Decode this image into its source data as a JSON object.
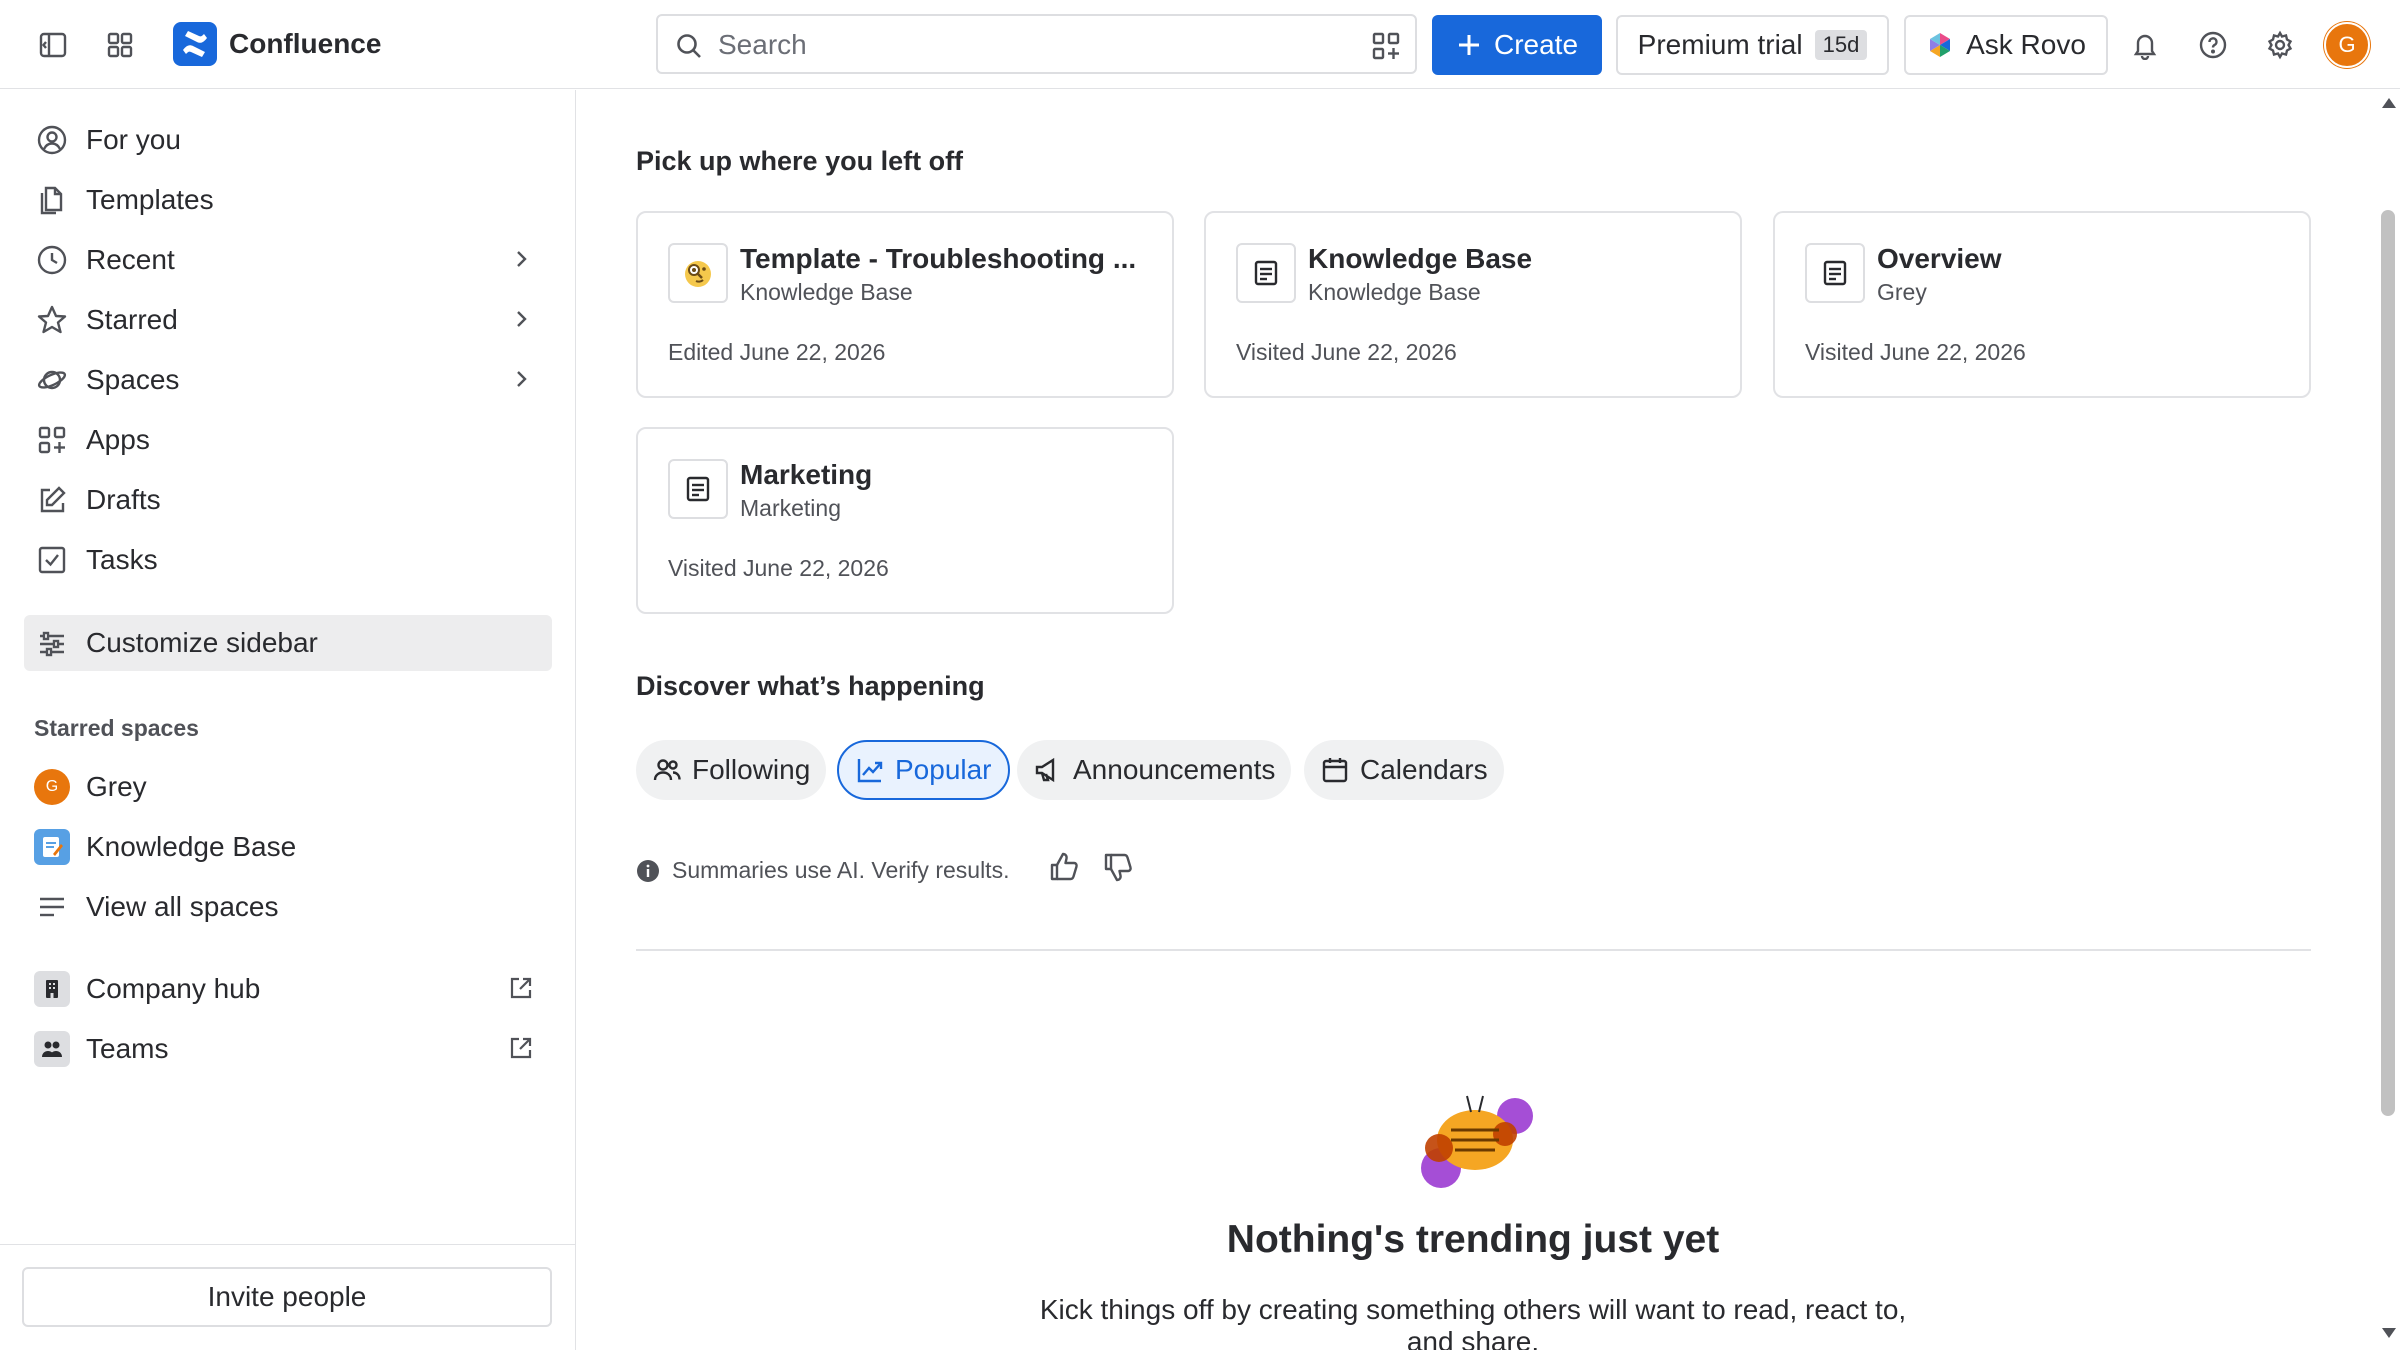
{
  "topbar": {
    "app_name": "Confluence",
    "search_placeholder": "Search",
    "create_label": "Create",
    "trial_label": "Premium trial",
    "trial_days": "15d",
    "rovo_label": "Ask Rovo",
    "user_initial": "G",
    "brand_color": "#1868db"
  },
  "sidebar": {
    "items": [
      {
        "label": "For you",
        "icon": "person-circle-icon"
      },
      {
        "label": "Templates",
        "icon": "templates-icon"
      },
      {
        "label": "Recent",
        "icon": "clock-icon"
      },
      {
        "label": "Starred",
        "icon": "star-icon"
      },
      {
        "label": "Spaces",
        "icon": "planet-icon"
      },
      {
        "label": "Apps",
        "icon": "apps-icon"
      },
      {
        "label": "Drafts",
        "icon": "edit-icon"
      },
      {
        "label": "Tasks",
        "icon": "checkbox-icon"
      }
    ],
    "customize_label": "Customize sidebar",
    "starred_spaces_title": "Starred spaces",
    "starred_spaces": [
      {
        "label": "Grey",
        "initial": "G"
      },
      {
        "label": "Knowledge Base"
      }
    ],
    "view_all_label": "View all spaces",
    "company_hub_label": "Company hub",
    "teams_label": "Teams",
    "invite_label": "Invite people"
  },
  "main": {
    "recent_heading": "Pick up where you left off",
    "cards": [
      {
        "title": "Template - Troubleshooting ...",
        "space": "Knowledge Base",
        "meta": "Edited June 22, 2026"
      },
      {
        "title": "Knowledge Base",
        "space": "Knowledge Base",
        "meta": "Visited June 22, 2026"
      },
      {
        "title": "Overview",
        "space": "Grey",
        "meta": "Visited June 22, 2026"
      },
      {
        "title": "Marketing",
        "space": "Marketing",
        "meta": "Visited June 22, 2026"
      }
    ],
    "discover_heading": "Discover what’s happening",
    "tabs": [
      {
        "label": "Following"
      },
      {
        "label": "Popular"
      },
      {
        "label": "Announcements"
      },
      {
        "label": "Calendars"
      }
    ],
    "ai_note": "Summaries use AI. Verify results.",
    "empty_title": "Nothing's trending just yet",
    "empty_text": "Kick things off by creating something others will want to read, react to, and share."
  }
}
